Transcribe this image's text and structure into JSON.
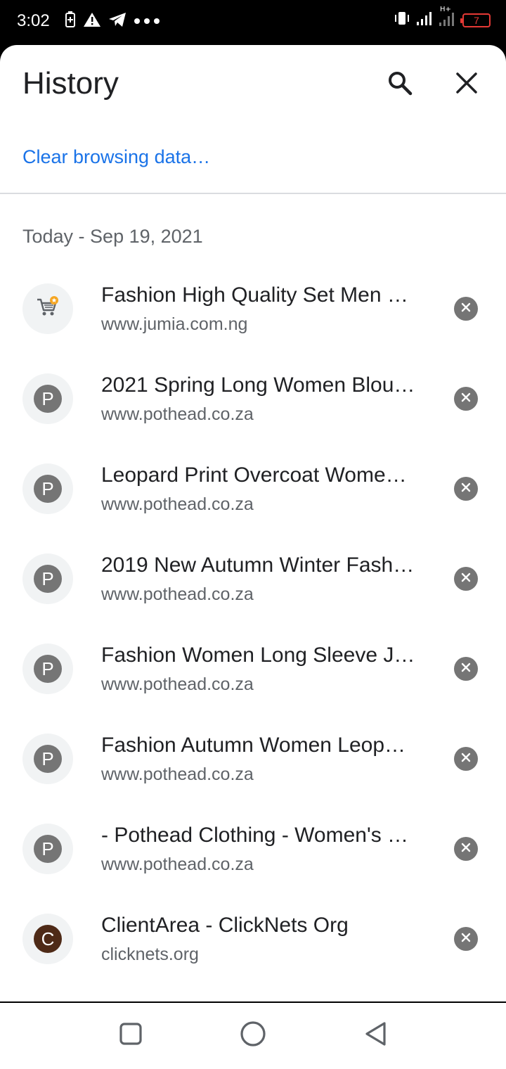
{
  "status_bar": {
    "time": "3:02",
    "battery_level": "7",
    "network_label": "H+",
    "left_icons": [
      "battery-saver-icon",
      "warning-icon",
      "telegram-icon",
      "more-dots-icon"
    ],
    "right_icons": [
      "vibrate-icon",
      "signal-icon",
      "signal-hplus-icon",
      "battery-low-icon"
    ]
  },
  "header": {
    "title": "History",
    "search_icon": "search-icon",
    "close_icon": "close-icon"
  },
  "clear_link": "Clear browsing data…",
  "date_header": "Today - Sep 19, 2021",
  "items": [
    {
      "title": "Fashion High Quality Set Men …",
      "url": "www.jumia.com.ng",
      "favicon": "cart-icon",
      "letter": ""
    },
    {
      "title": "2021 Spring Long Women Blou…",
      "url": "www.pothead.co.za",
      "favicon": "letter",
      "letter": "P"
    },
    {
      "title": "Leopard Print Overcoat Wome…",
      "url": "www.pothead.co.za",
      "favicon": "letter",
      "letter": "P"
    },
    {
      "title": "2019 New Autumn Winter Fash…",
      "url": "www.pothead.co.za",
      "favicon": "letter",
      "letter": "P"
    },
    {
      "title": "Fashion Women Long Sleeve J…",
      "url": "www.pothead.co.za",
      "favicon": "letter",
      "letter": "P"
    },
    {
      "title": "Fashion Autumn Women Leop…",
      "url": "www.pothead.co.za",
      "favicon": "letter",
      "letter": "P"
    },
    {
      "title": "- Pothead Clothing - Women's …",
      "url": "www.pothead.co.za",
      "favicon": "letter",
      "letter": "P"
    },
    {
      "title": "ClientArea - ClickNets Org",
      "url": "clicknets.org",
      "favicon": "letter",
      "letter": "C"
    }
  ],
  "nav": [
    "recents-square-icon",
    "home-circle-icon",
    "back-triangle-icon"
  ],
  "colors": {
    "accent": "#1a73e8",
    "battery": "#e53935",
    "favicon_grey": "#757575",
    "favicon_brown": "#4e2a17",
    "cart_star": "#f5a623"
  }
}
